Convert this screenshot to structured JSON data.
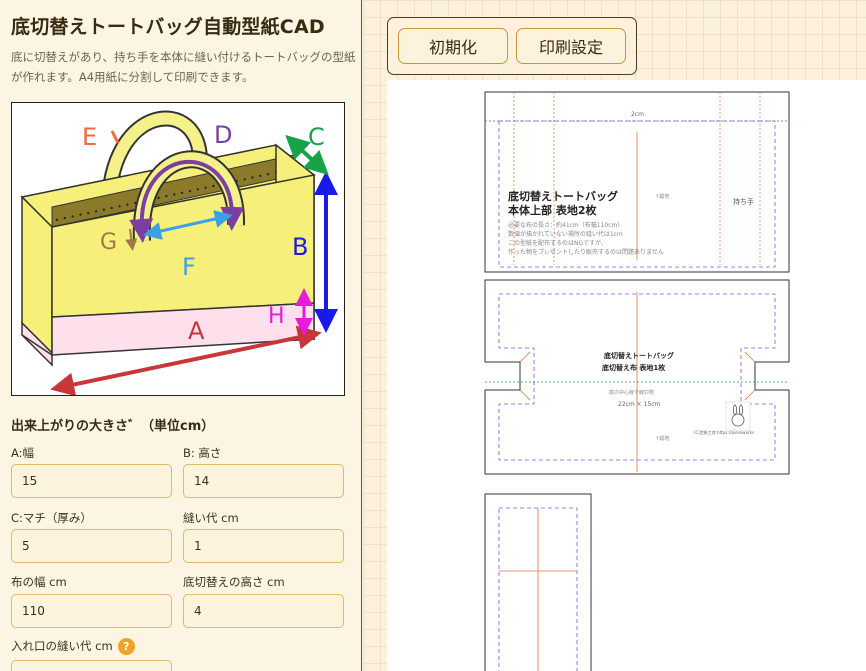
{
  "app": {
    "title": "底切替えトートバッグ自動型紙CAD",
    "description": "底に切替えがあり、持ち手を本体に縫い付けるトートバッグの型紙が作れます。A4用紙に分割して印刷できます。"
  },
  "illustration": {
    "labels": {
      "a": "A",
      "b": "B",
      "c": "C",
      "d": "D",
      "e": "E",
      "f": "F",
      "g": "G",
      "h": "H"
    },
    "colors": {
      "body": "#f6f07a",
      "bottom": "#fde0ec",
      "handle": "#f4f08a",
      "a": "#c8363a",
      "b": "#1a1ae8",
      "c": "#17a34a",
      "d": "#7b3fa3",
      "e": "#f06a3a",
      "f": "#3aa0e8",
      "g": "#a07848",
      "h": "#e81adb"
    }
  },
  "form": {
    "section_title": "出来上がりの大きさ゛（単位cm）",
    "width": {
      "label": "A:幅",
      "value": "15"
    },
    "height": {
      "label": "B: 高さ",
      "value": "14"
    },
    "gusset": {
      "label": "C:マチ（厚み）",
      "value": "5"
    },
    "seam": {
      "label": "縫い代 cm",
      "value": "1"
    },
    "fabric_width": {
      "label": "布の幅 cm",
      "value": "110"
    },
    "bottom_height": {
      "label": "底切替えの高さ cm",
      "value": "4"
    },
    "opening_seam": {
      "label": "入れ口の縫い代 cm",
      "help_icon": "question-icon",
      "help": "?"
    }
  },
  "toolbar": {
    "reset_label": "初期化",
    "print_label": "印刷設定"
  },
  "pattern": {
    "piece1": {
      "dim_top": "2cm",
      "title1": "底切替えトートバッグ",
      "title2": "本体上部 表地2枚",
      "note1": "必要な布の長さ：約41cm（布幅110cm）",
      "note2": "数値が描かれていない場所の縫い代は1cm",
      "note3": "この型紙を配布するのはNGですが、",
      "note4": "作った物をプレゼントしたり販売するのは問題ありません",
      "handle_label": "持ち手",
      "vert_label": "↑縦地"
    },
    "piece2": {
      "title1": "底切替えトートバッグ",
      "title2": "底切替え布 表地1枚",
      "center_note": "底の中心線で線対称",
      "size": "22cm × 15cm",
      "vert_label": "↑縦地",
      "credit": "(C)型紙工房 https://pieceworks"
    }
  }
}
